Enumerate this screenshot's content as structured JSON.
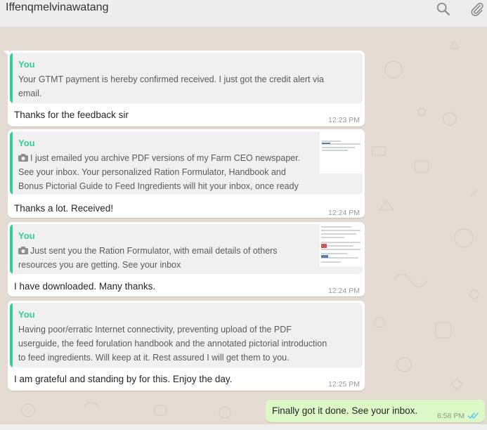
{
  "header": {
    "contact_name": "Iffenqmelvinawatang",
    "search_icon": "search-icon",
    "attach_icon": "paperclip-icon"
  },
  "messages": [
    {
      "quote": {
        "author": "You",
        "lines": [
          "Your GTMT payment is hereby confirmed received. I just got the credit alert via",
          "email."
        ],
        "has_photo": false
      },
      "reply": "Thanks for the feedback sir",
      "time": "12:23 PM"
    },
    {
      "quote": {
        "author": "You",
        "lines": [
          "I just emailed you archive PDF versions of my Farm CEO newspaper.",
          "See your inbox. Your personalized Ration Formulator, Handbook and",
          "Bonus Pictorial Guide to Feed Ingredients will hit your inbox, once ready"
        ],
        "has_photo": true
      },
      "reply": "Thanks a lot. Received!",
      "time": "12:24 PM"
    },
    {
      "quote": {
        "author": "You",
        "lines": [
          "Just sent you the Ration Formulator, with email details of others",
          "resources you are getting. See your inbox"
        ],
        "has_photo": true
      },
      "reply": "I have downloaded. Many thanks.",
      "time": "12:24 PM"
    },
    {
      "quote": {
        "author": "You",
        "lines": [
          "Having poor/erratic Internet connectivity, preventing upload of the PDF",
          "userguide, the feed forulation handbook and the annotated pictorial introduction",
          "to feed ingredients. Will keep at it. Rest assured I will get them to you."
        ],
        "has_photo": false
      },
      "reply": "I am grateful and standing by for this. Enjoy the day.",
      "time": "12:25 PM"
    }
  ],
  "outgoing": {
    "text": "Finally got it done. See your inbox.",
    "time": "6:58 PM",
    "status": "read",
    "tick_color": "#4fc3f7"
  },
  "colors": {
    "quote_accent": "#35cd96",
    "outgoing_bubble": "#dcf8c6",
    "chat_bg": "#e5ddd5"
  }
}
